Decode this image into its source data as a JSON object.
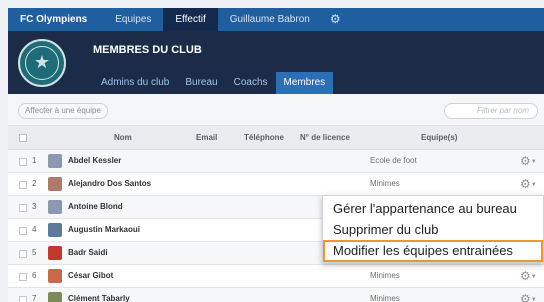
{
  "topnav": {
    "brand": "FC Olympiens",
    "items": [
      "Equipes",
      "Effectif",
      "Guillaume Babron"
    ],
    "active_index": 1,
    "gear_icon": "gear-icon"
  },
  "club": {
    "title": "MEMBRES DU CLUB",
    "logo_text": "OLYMPIENS",
    "tabs": [
      "Admins du club",
      "Bureau",
      "Coachs",
      "Membres"
    ],
    "active_tab": "Membres"
  },
  "toolbar": {
    "affecter_label": "Affecter à une équipe",
    "filter_placeholder": "Filtrer par nom"
  },
  "table": {
    "headers": {
      "nom": "Nom",
      "email": "Email",
      "telephone": "Téléphone",
      "licence": "N° de licence",
      "equipes": "Equipe(s)"
    },
    "rows": [
      {
        "num": "1",
        "name": "Abdel Kessler",
        "team": "Ecole de foot",
        "avatar": "#8a98b3"
      },
      {
        "num": "2",
        "name": "Alejandro Dos Santos",
        "team": "Minimes",
        "avatar": "#b07a6a"
      },
      {
        "num": "3",
        "name": "Antoine Blond",
        "team": "",
        "avatar": "#8a98b3"
      },
      {
        "num": "4",
        "name": "Augustin Markaoui",
        "team": "",
        "avatar": "#5e7a9b"
      },
      {
        "num": "5",
        "name": "Badr Saidi",
        "team": "",
        "avatar": "#c0392b"
      },
      {
        "num": "6",
        "name": "César Gibot",
        "team": "Minimes",
        "avatar": "#c86a4a"
      },
      {
        "num": "7",
        "name": "Clément Tabarly",
        "team": "Minimes",
        "avatar": "#7a8a5a"
      }
    ]
  },
  "dropdown": {
    "items": [
      "Gérer l'appartenance au bureau",
      "Supprimer du club",
      "Modifier les équipes entrainées"
    ],
    "highlight_index": 2,
    "highlight_color": "#f0962e"
  }
}
